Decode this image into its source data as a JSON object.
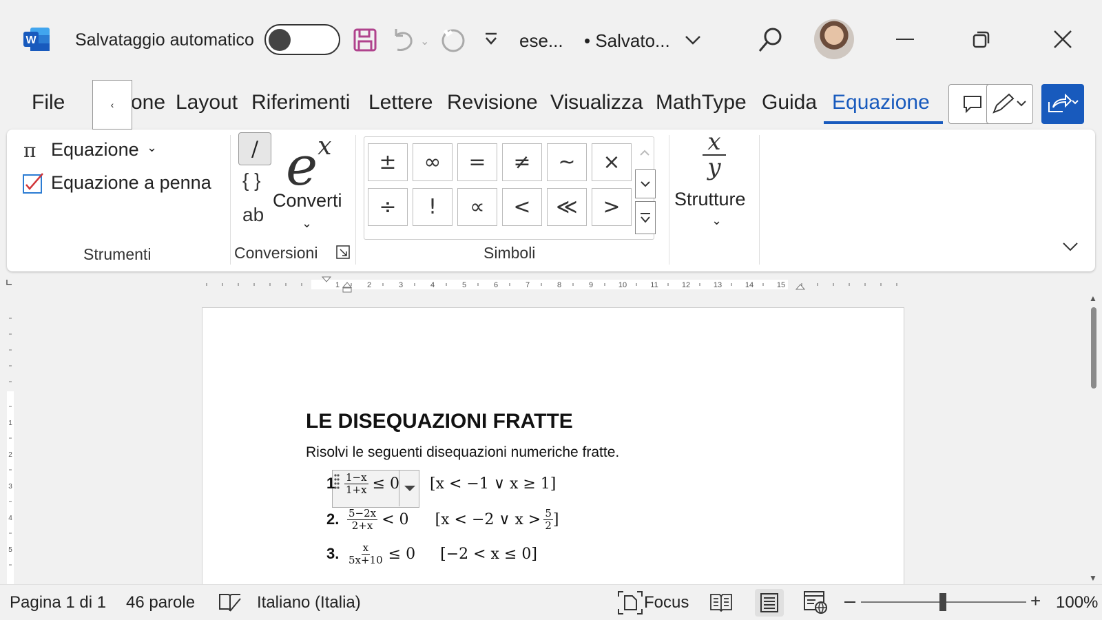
{
  "titlebar": {
    "autosave_label": "Salvataggio automatico",
    "doc_name": "ese...",
    "save_state": "• Salvato...",
    "app_icon_letter": "W"
  },
  "tabs": [
    {
      "label": "File"
    },
    {
      "label": "one"
    },
    {
      "label": "Layout"
    },
    {
      "label": "Riferimenti"
    },
    {
      "label": "Lettere"
    },
    {
      "label": "Revisione"
    },
    {
      "label": "Visualizza"
    },
    {
      "label": "MathType"
    },
    {
      "label": "Guida"
    },
    {
      "label": "Equazione"
    }
  ],
  "tab_scroll_glyph": "‹",
  "ribbon": {
    "strumenti": {
      "equazione": "Equazione",
      "equazione_penna": "Equazione a penna",
      "group_label": "Strumenti"
    },
    "conversioni": {
      "braces": "{ }",
      "ab": "ab",
      "converti": "Converti",
      "group_label": "Conversioni"
    },
    "simboli": {
      "row1": [
        "±",
        "∞",
        "=",
        "≠",
        "~",
        "×"
      ],
      "row2": [
        "÷",
        "!",
        "∝",
        "<",
        "≪",
        ">"
      ],
      "group_label": "Simboli"
    },
    "strutture": {
      "label": "Strutture"
    }
  },
  "document": {
    "title": "LE DISEQUAZIONI FRATTE",
    "subtitle": "Risolvi le seguenti disequazioni numeriche fratte.",
    "items": [
      {
        "num": "1",
        "numer": "1−x",
        "denom": "1+x",
        "rel": "≤ 0",
        "sol": "[x < −1 ∨ x ≥ 1]"
      },
      {
        "num": "2.",
        "numer": "5−2x",
        "denom": "2+x",
        "rel": "< 0",
        "sol_prefix": "[x < −2 ∨ x >",
        "sol_numer": "5",
        "sol_denom": "2",
        "sol_suffix": "]"
      },
      {
        "num": "3.",
        "numer": "x",
        "denom": "5x+10",
        "rel": "≤ 0",
        "sol": "[−2 < x ≤ 0]"
      }
    ]
  },
  "statusbar": {
    "page": "Pagina 1 di 1",
    "words": "46 parole",
    "language": "Italiano (Italia)",
    "focus": "Focus",
    "zoom": "100%"
  },
  "colors": {
    "accent": "#185abd",
    "save_icon": "#b0438d"
  }
}
